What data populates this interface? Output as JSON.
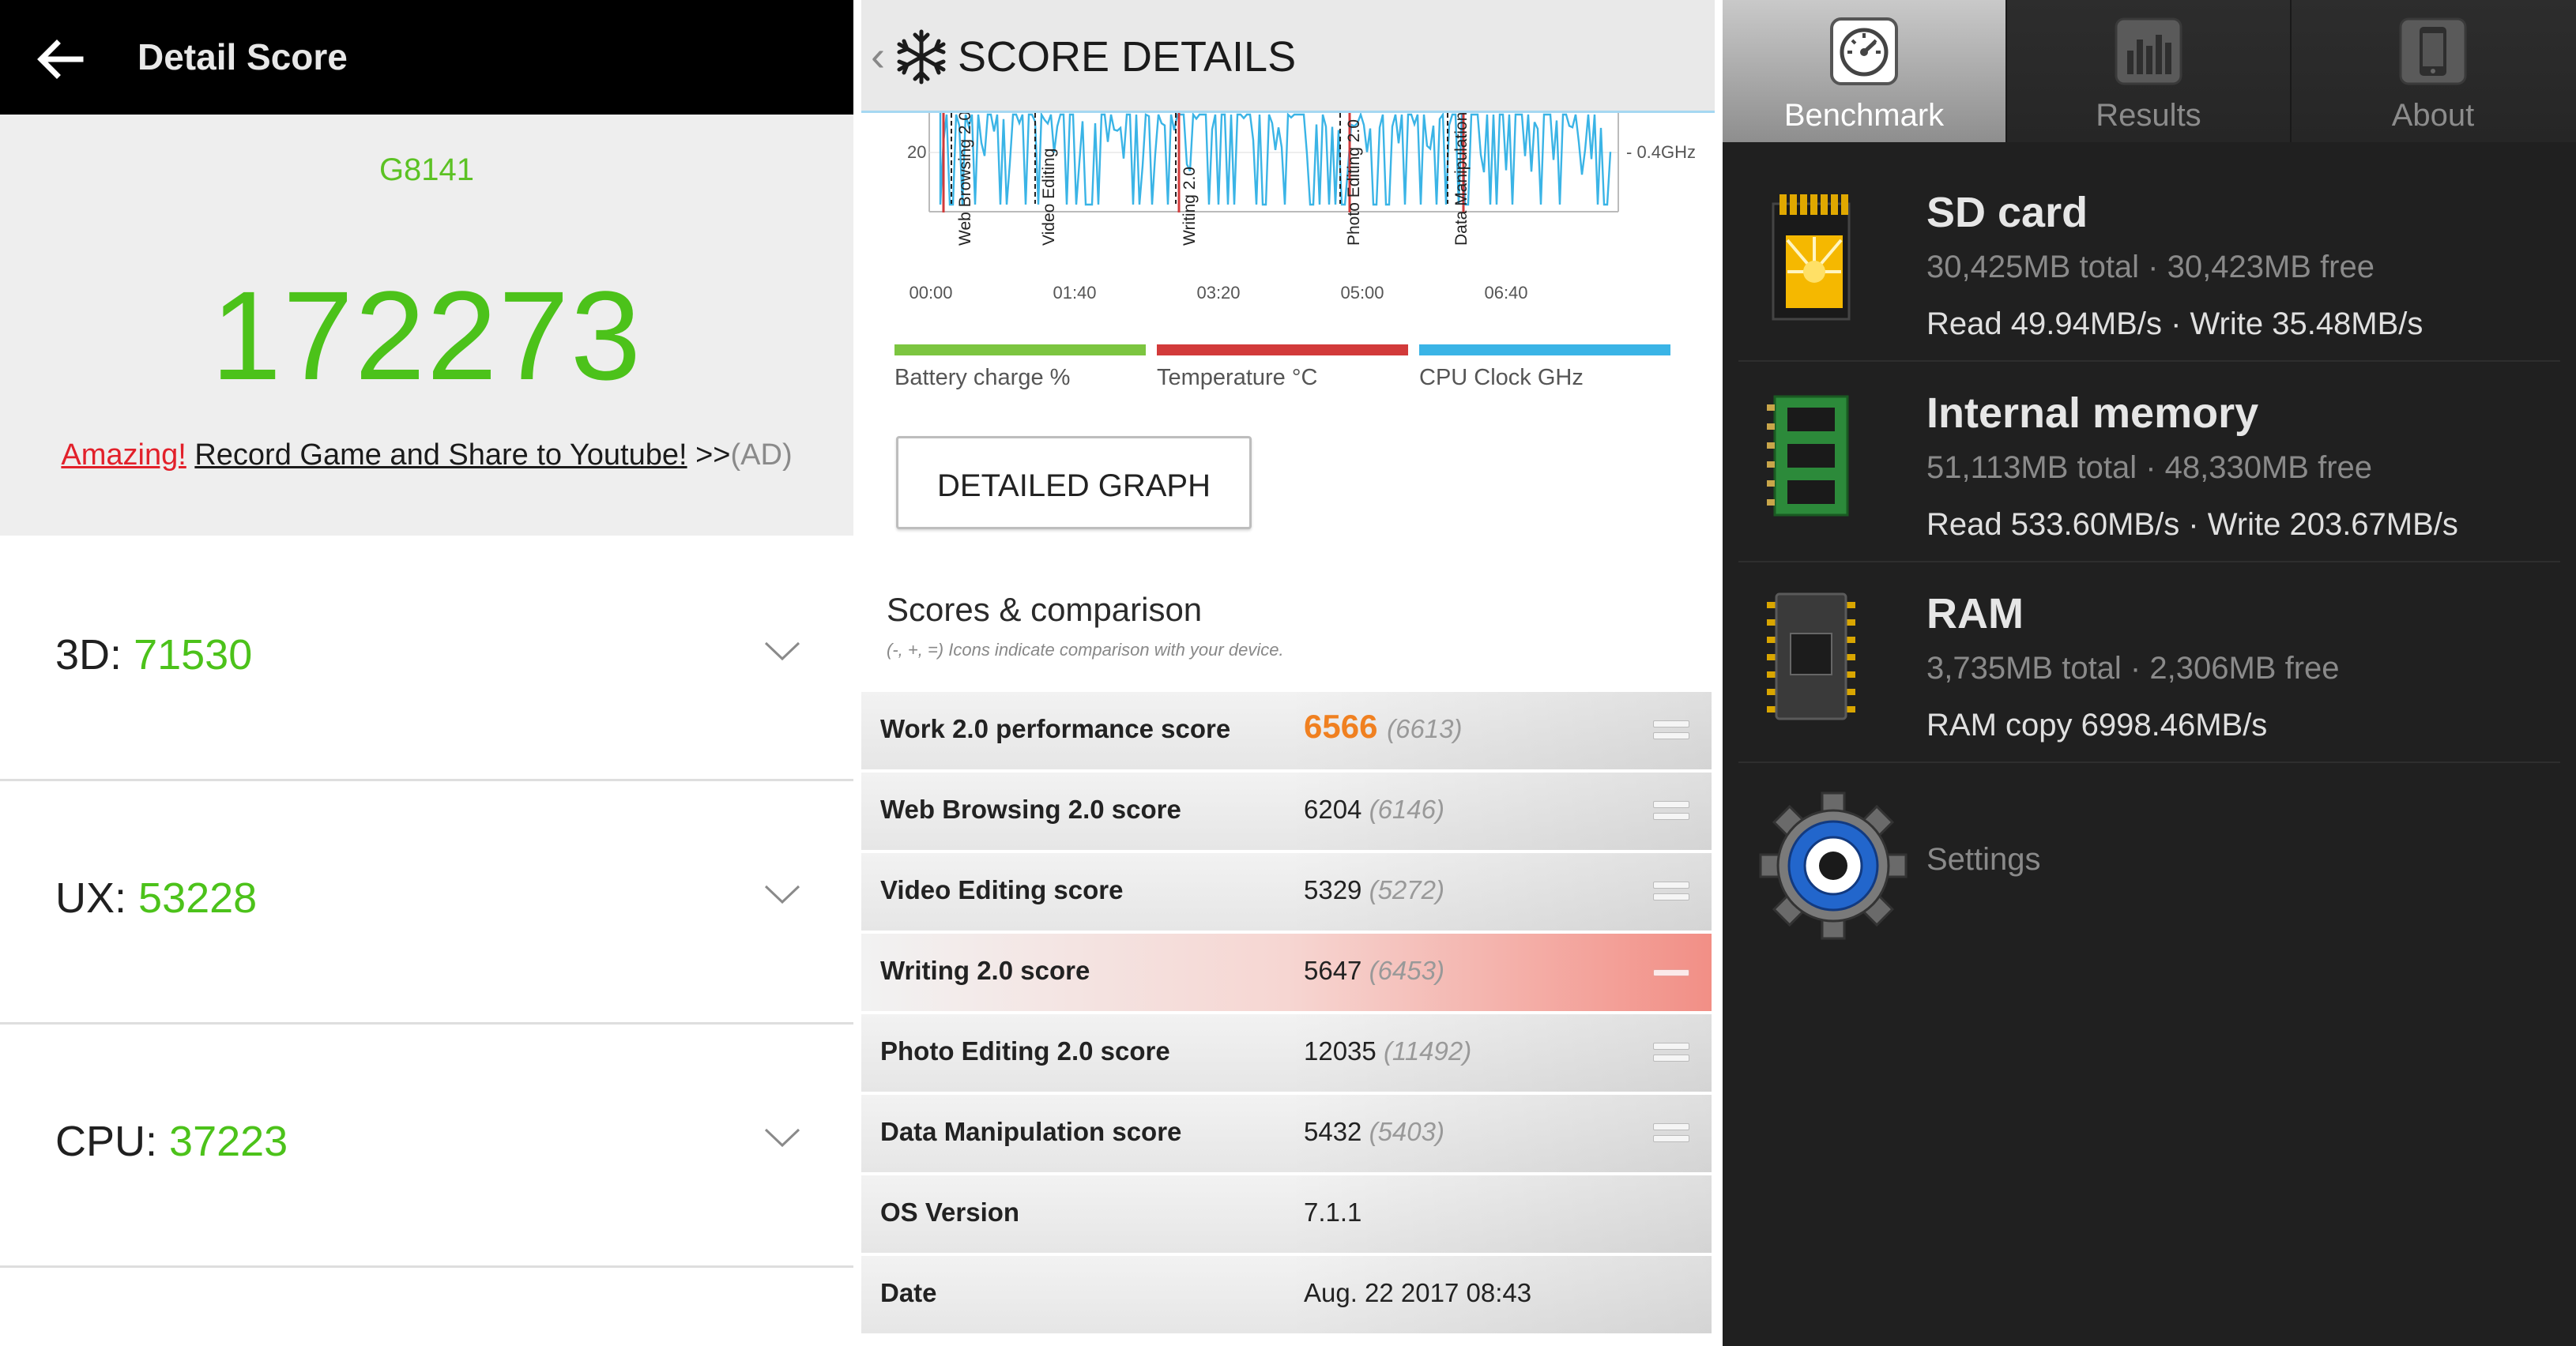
{
  "detail_score": {
    "title": "Detail Score",
    "device": "G8141",
    "total_score": "172273",
    "ad": {
      "amazing": "Amazing!",
      "record": "Record Game and Share to Youtube!",
      "arrows": " >>",
      "tag": "(AD)"
    },
    "rows": [
      {
        "label": "3D:",
        "value": "71530"
      },
      {
        "label": "UX:",
        "value": "53228"
      },
      {
        "label": "CPU:",
        "value": "37223"
      }
    ]
  },
  "score_details": {
    "title": "SCORE DETAILS",
    "chart_data": {
      "type": "line",
      "x_ticks": [
        "00:00",
        "01:40",
        "03:20",
        "05:00",
        "06:40"
      ],
      "y_left_tick": "20",
      "y_right_tick": "0.4GHz",
      "markers": [
        "Web Browsing 2.0",
        "Video Editing",
        "Writing 2.0",
        "Photo Editing 2.0",
        "Data Manipulation"
      ],
      "legend": [
        {
          "label": "Battery charge %",
          "color": "#7cc540"
        },
        {
          "label": "Temperature °C",
          "color": "#d23a3a"
        },
        {
          "label": "CPU Clock GHz",
          "color": "#3ab4e6"
        }
      ]
    },
    "detailed_graph_button": "DETAILED GRAPH",
    "scores_title": "Scores & comparison",
    "scores_note": "(-, +, =) Icons indicate comparison with your device.",
    "rows": [
      {
        "name": "Work 2.0 performance score",
        "value": "6566",
        "comparison": "(6613)",
        "indicator": "equal"
      },
      {
        "name": "Web Browsing 2.0 score",
        "value": "6204",
        "comparison": "(6146)",
        "indicator": "equal"
      },
      {
        "name": "Video Editing score",
        "value": "5329",
        "comparison": "(5272)",
        "indicator": "equal"
      },
      {
        "name": "Writing 2.0 score",
        "value": "5647",
        "comparison": "(6453)",
        "indicator": "minus"
      },
      {
        "name": "Photo Editing 2.0 score",
        "value": "12035",
        "comparison": "(11492)",
        "indicator": "equal"
      },
      {
        "name": "Data Manipulation score",
        "value": "5432",
        "comparison": "(5403)",
        "indicator": "equal"
      },
      {
        "name": "OS Version",
        "value": "7.1.1",
        "comparison": "",
        "indicator": "none"
      },
      {
        "name": "Date",
        "value": "Aug. 22 2017 08:43",
        "comparison": "",
        "indicator": "none"
      }
    ]
  },
  "benchmark": {
    "tabs": [
      {
        "label": "Benchmark",
        "icon": "speedometer-icon",
        "active": true
      },
      {
        "label": "Results",
        "icon": "bar-chart-icon",
        "active": false
      },
      {
        "label": "About",
        "icon": "phone-icon",
        "active": false
      }
    ],
    "items": [
      {
        "title": "SD card",
        "sub": "30,425MB total · 30,423MB free",
        "result": "Read 49.94MB/s · Write 35.48MB/s",
        "icon": "sd-card-icon"
      },
      {
        "title": "Internal memory",
        "sub": "51,113MB total · 48,330MB free",
        "result": "Read 533.60MB/s · Write 203.67MB/s",
        "icon": "memory-chip-icon"
      },
      {
        "title": "RAM",
        "sub": "3,735MB total · 2,306MB free",
        "result": "RAM copy 6998.46MB/s",
        "icon": "ram-chip-icon"
      }
    ],
    "settings_label": "Settings"
  }
}
